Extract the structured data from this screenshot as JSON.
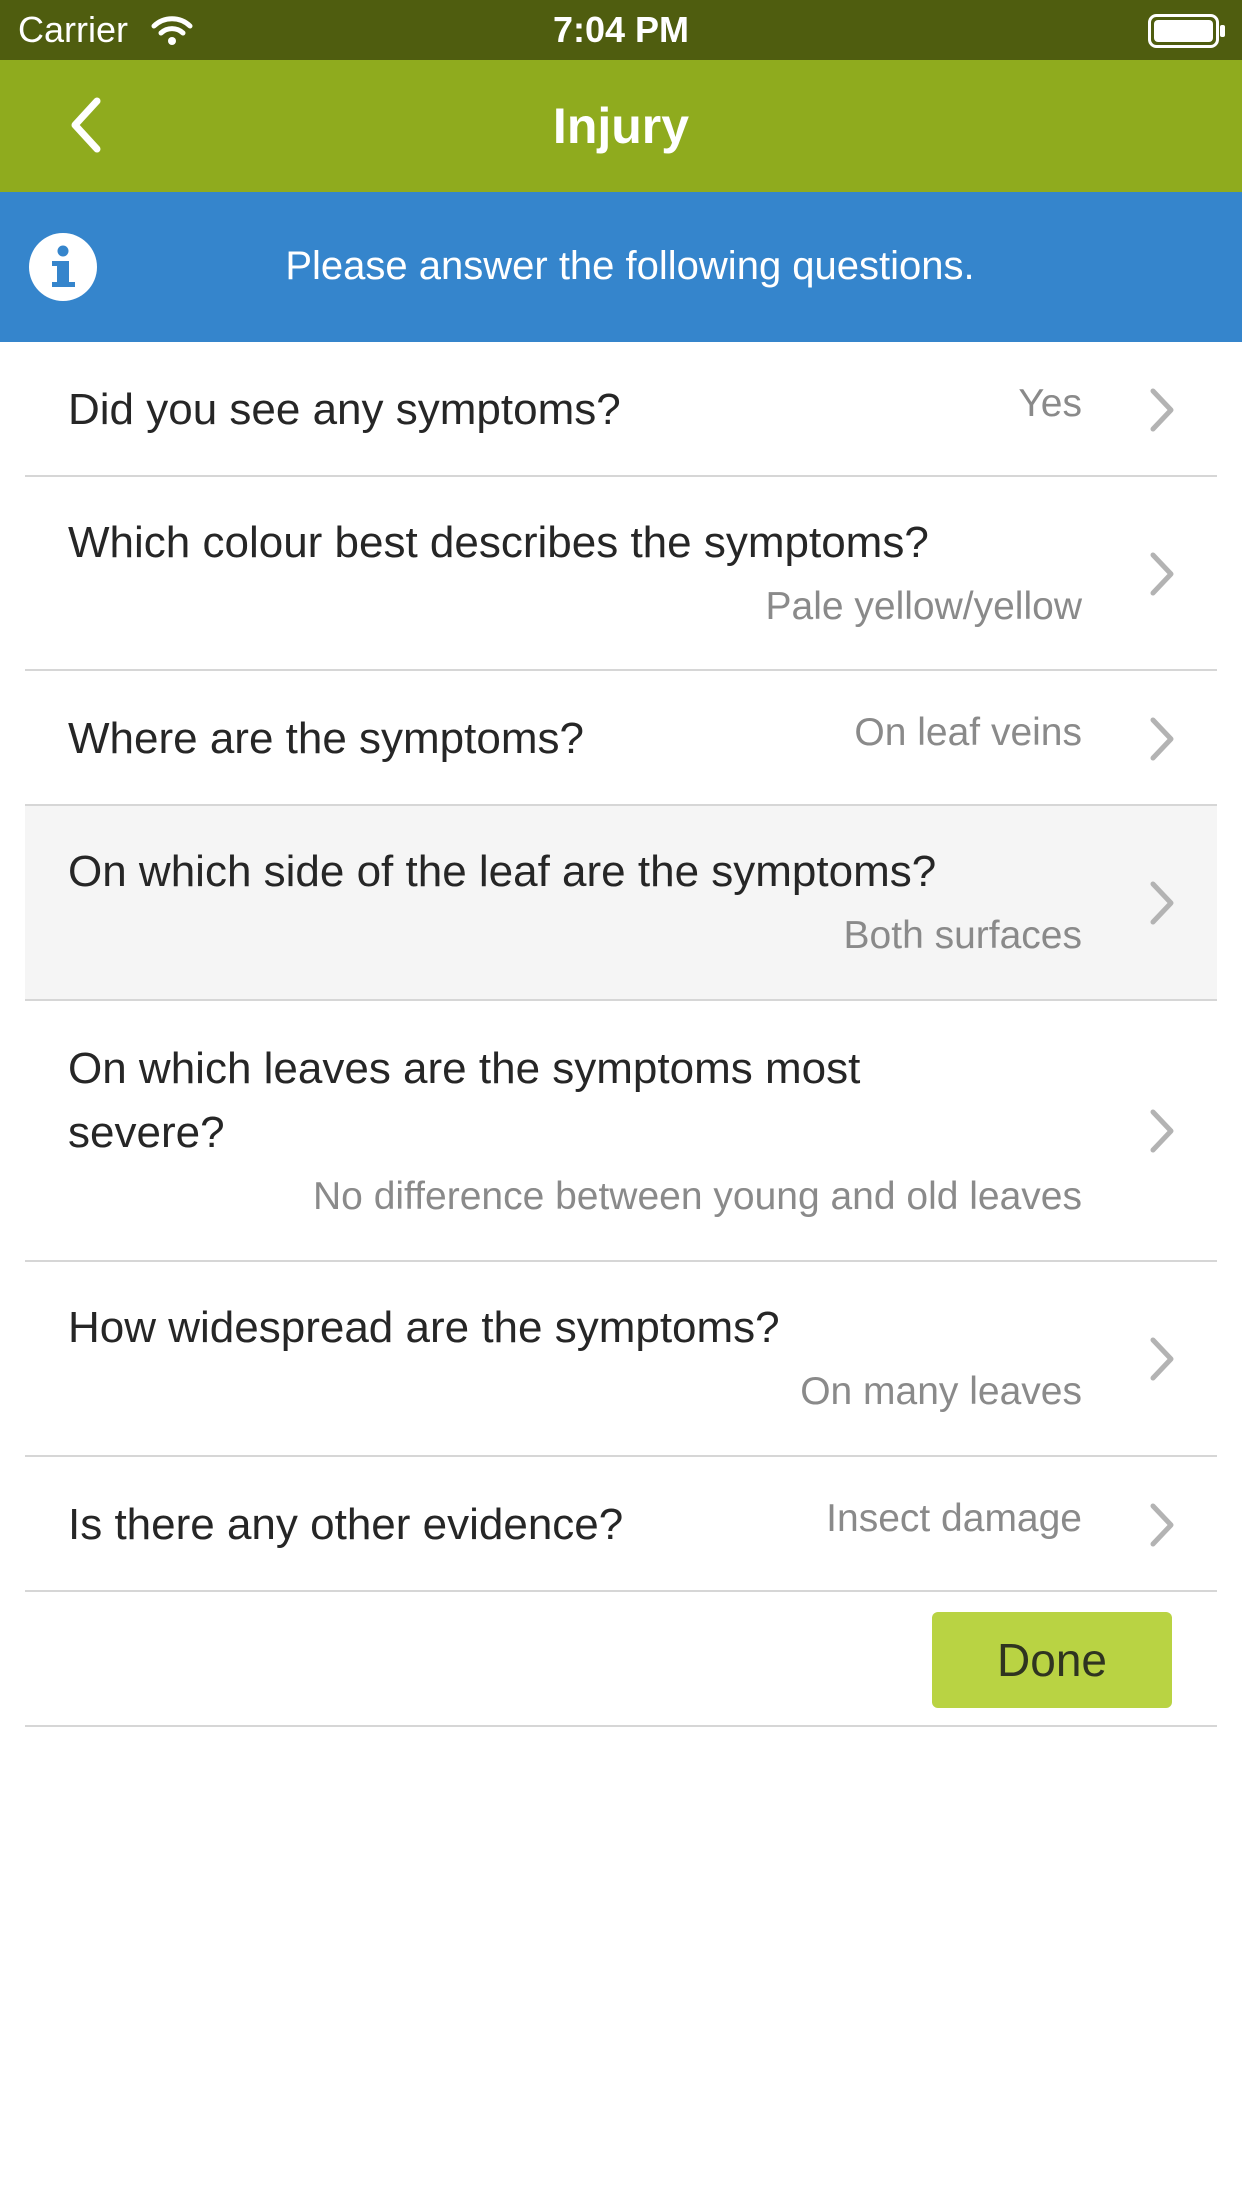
{
  "status_bar": {
    "carrier": "Carrier",
    "time": "7:04 PM",
    "wifi_icon": "wifi-icon",
    "battery_icon": "battery-full-icon"
  },
  "nav": {
    "title": "Injury",
    "back_icon": "chevron-left-icon"
  },
  "banner": {
    "icon": "info-icon",
    "text": "Please answer the following questions."
  },
  "questions": [
    {
      "question": "Did you see any symptoms?",
      "answer": "Yes"
    },
    {
      "question": "Which colour best describes the symptoms?",
      "answer": "Pale yellow/yellow"
    },
    {
      "question": "Where are the symptoms?",
      "answer": "On leaf veins"
    },
    {
      "question": "On which side of the leaf are the symptoms?",
      "answer": "Both surfaces"
    },
    {
      "question": "On which leaves are the symptoms most severe?",
      "answer": "No difference between young and old leaves"
    },
    {
      "question": "How widespread are the symptoms?",
      "answer": "On many leaves"
    },
    {
      "question": "Is there any other evidence?",
      "answer": "Insect damage"
    }
  ],
  "done_label": "Done",
  "colors": {
    "status_bar": "#4f5d0f",
    "nav_bar": "#8fab1e",
    "banner": "#3585cc",
    "done_button": "#b9d343",
    "answer_text": "#8a8a8a",
    "chevron": "#b3b3b3"
  }
}
